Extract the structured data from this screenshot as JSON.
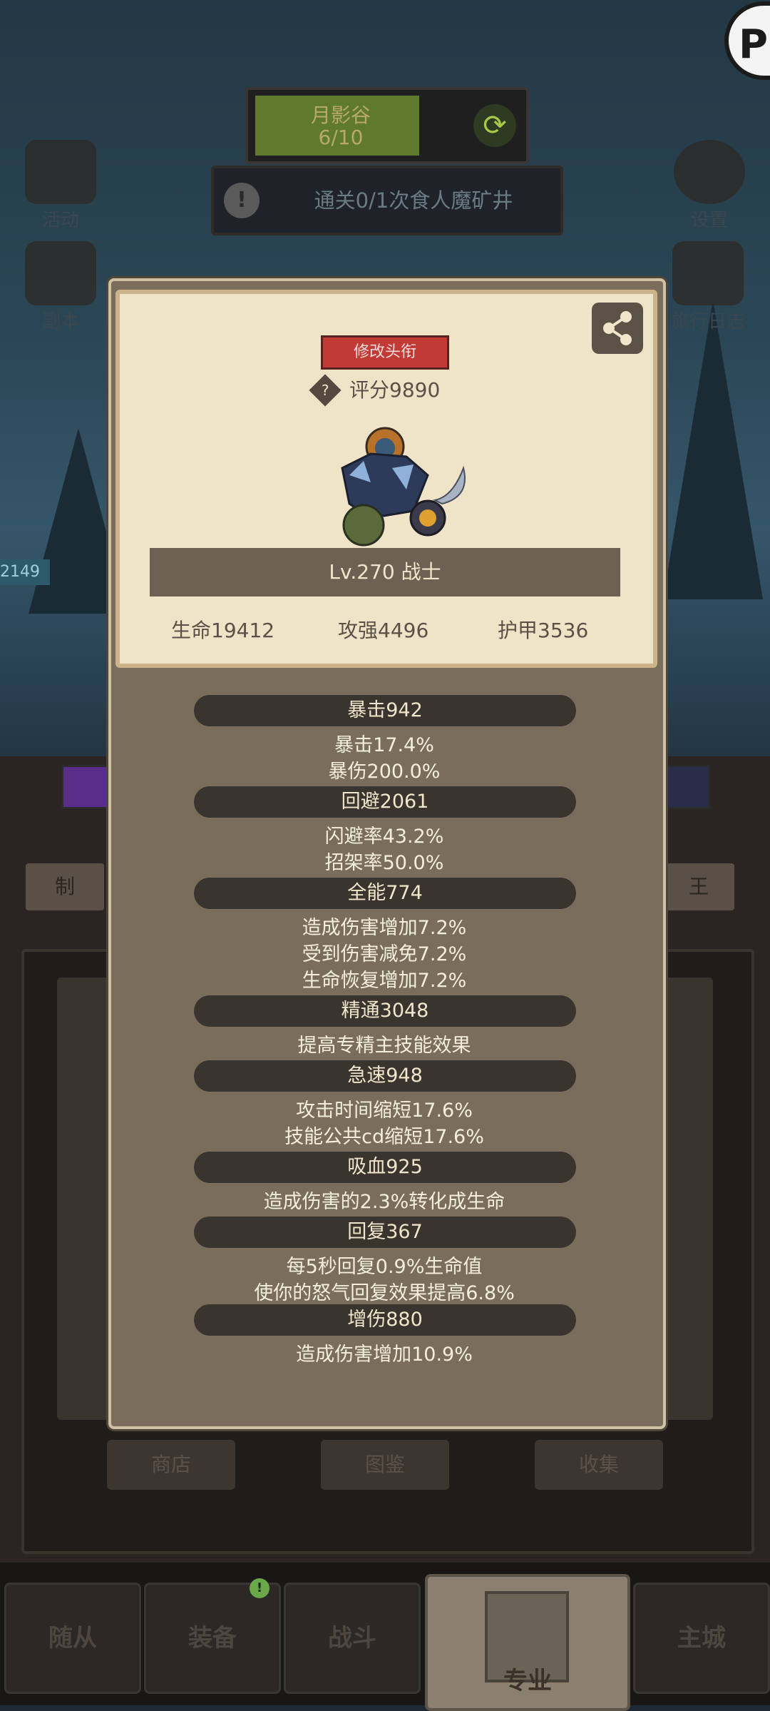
{
  "zone": {
    "name": "月影谷",
    "progress": "6/10"
  },
  "quest": {
    "text": "通关0/1次食人魔矿井"
  },
  "side_icons": {
    "activity": "活动",
    "settings": "设置",
    "dungeon": "副本",
    "journal": "旅行日志"
  },
  "hud": {
    "hp_badge": "2149"
  },
  "card": {
    "change_title": "修改头衔",
    "score": "评分9890",
    "level_class": "Lv.270 战士",
    "hp": "生命19412",
    "attack": "攻强4496",
    "armor": "护甲3536"
  },
  "stats": [
    {
      "header": "暴击942",
      "lines": [
        "暴击17.4%",
        "暴伤200.0%"
      ]
    },
    {
      "header": "回避2061",
      "lines": [
        "闪避率43.2%",
        "招架率50.0%"
      ]
    },
    {
      "header": "全能774",
      "lines": [
        "造成伤害增加7.2%",
        "受到伤害减免7.2%",
        "生命恢复增加7.2%"
      ]
    },
    {
      "header": "精通3048",
      "lines": [
        "提高专精主技能效果"
      ]
    },
    {
      "header": "急速948",
      "lines": [
        "攻击时间缩短17.6%",
        "技能公共cd缩短17.6%"
      ]
    },
    {
      "header": "吸血925",
      "lines": [
        "造成伤害的2.3%转化成生命"
      ]
    },
    {
      "header": "回复367",
      "lines": [
        "每5秒回复0.9%生命值",
        "使你的怒气回复效果提高6.8%"
      ]
    },
    {
      "header": "增伤880",
      "lines": [
        "造成伤害增加10.9%"
      ]
    }
  ],
  "background_tabs": {
    "left": "制",
    "right": "王"
  },
  "background_buttons": [
    "商店",
    "图鉴",
    "收集"
  ],
  "bottom_nav": [
    "随从",
    "装备",
    "战斗",
    "专业",
    "主城"
  ],
  "colors": {
    "accent_red": "#c23a36",
    "card_bg": "#efe3c8",
    "dialog_bg": "#7a6d5c",
    "section_bar": "#3a342e"
  }
}
